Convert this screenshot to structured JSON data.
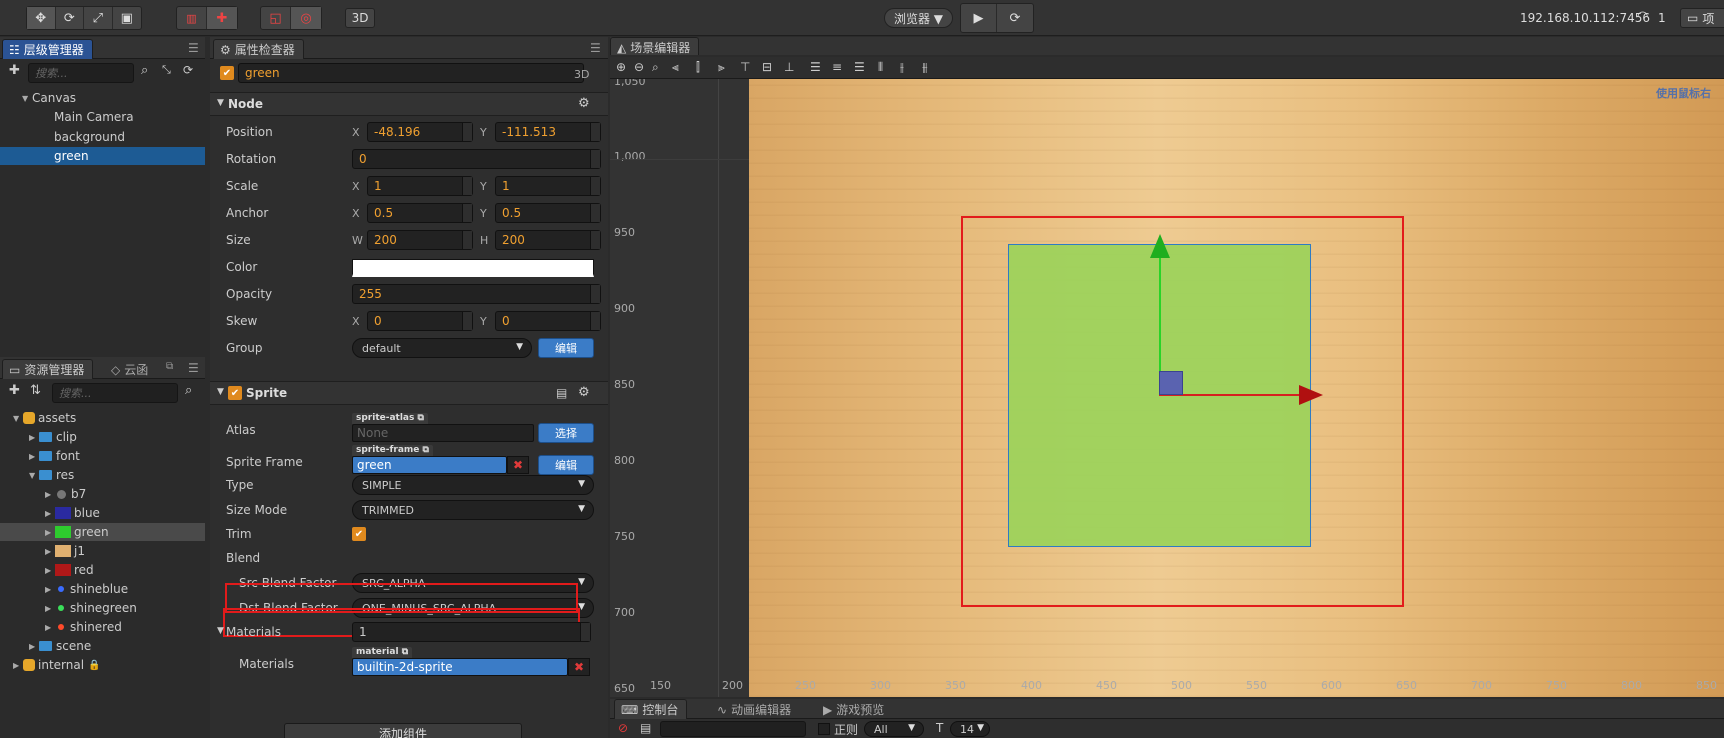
{
  "topbar": {
    "browser_label": "浏览器 ▼",
    "ip": "192.168.10.112:7456",
    "count": "1",
    "project_label": "项",
    "mode_3d": "3D"
  },
  "hierarchy": {
    "tab": "层级管理器",
    "search_placeholder": "搜索...",
    "nodes": [
      {
        "label": "Canvas"
      },
      {
        "label": "Main Camera"
      },
      {
        "label": "background"
      },
      {
        "label": "green"
      }
    ]
  },
  "assets": {
    "tab": "资源管理器",
    "tab2": "云函",
    "search_placeholder": "搜索...",
    "items": [
      {
        "label": "assets"
      },
      {
        "label": "clip"
      },
      {
        "label": "font"
      },
      {
        "label": "res"
      },
      {
        "label": "b7"
      },
      {
        "label": "blue"
      },
      {
        "label": "green"
      },
      {
        "label": "j1"
      },
      {
        "label": "red"
      },
      {
        "label": "shineblue"
      },
      {
        "label": "shinegreen"
      },
      {
        "label": "shinered"
      },
      {
        "label": "scene"
      },
      {
        "label": "internal"
      }
    ]
  },
  "inspector": {
    "tab": "属性检查器",
    "node_name": "green",
    "badge_3d": "3D",
    "node_section": "Node",
    "props": {
      "position": {
        "label": "Position",
        "x_label": "X",
        "x": "-48.196",
        "y_label": "Y",
        "y": "-111.513"
      },
      "rotation": {
        "label": "Rotation",
        "value": "0"
      },
      "scale": {
        "label": "Scale",
        "x_label": "X",
        "x": "1",
        "y_label": "Y",
        "y": "1"
      },
      "anchor": {
        "label": "Anchor",
        "x_label": "X",
        "x": "0.5",
        "y_label": "Y",
        "y": "0.5"
      },
      "size": {
        "label": "Size",
        "w_label": "W",
        "w": "200",
        "h_label": "H",
        "h": "200"
      },
      "color": {
        "label": "Color",
        "value": "#ffffff"
      },
      "opacity": {
        "label": "Opacity",
        "value": "255"
      },
      "skew": {
        "label": "Skew",
        "x_label": "X",
        "x": "0",
        "y_label": "Y",
        "y": "0"
      },
      "group": {
        "label": "Group",
        "value": "default",
        "edit": "编辑"
      }
    },
    "sprite_section": "Sprite",
    "sprite": {
      "atlas": {
        "label": "Atlas",
        "tag": "sprite-atlas",
        "value": "None",
        "btn": "选择"
      },
      "frame": {
        "label": "Sprite Frame",
        "tag": "sprite-frame",
        "value": "green",
        "btn": "编辑"
      },
      "type": {
        "label": "Type",
        "value": "SIMPLE"
      },
      "size_mode": {
        "label": "Size Mode",
        "value": "TRIMMED"
      },
      "trim": {
        "label": "Trim"
      },
      "blend": {
        "label": "Blend"
      },
      "src": {
        "label": "Src Blend Factor",
        "value": "SRC_ALPHA"
      },
      "dst": {
        "label": "Dst Blend Factor",
        "value": "ONE_MINUS_SRC_ALPHA"
      },
      "materials_count": {
        "label": "Materials",
        "value": "1"
      },
      "materials": {
        "label": "Materials",
        "tag": "material",
        "value": "builtin-2d-sprite"
      }
    },
    "add_component": "添加组件"
  },
  "scene": {
    "tab": "场景编辑器",
    "hint": "使用鼠标右",
    "y_ruler": [
      "1,050",
      "1,000",
      "950",
      "900",
      "850",
      "800",
      "750",
      "700",
      "650"
    ],
    "x_ruler": [
      "150",
      "200",
      "250",
      "300",
      "350",
      "400",
      "450",
      "500",
      "550",
      "600",
      "650",
      "700",
      "750",
      "800",
      "850"
    ]
  },
  "bottom": {
    "tabs": [
      "控制台",
      "动画编辑器",
      "游戏预览"
    ],
    "regex_label": "正则",
    "filter_value": "All",
    "font_size": "14"
  },
  "colors": {
    "accent": "#2b5394",
    "selection": "#1d5b94",
    "highlight_red": "#e21b1b",
    "orange_value": "#f0a030",
    "green_sprite": "#9fd15f"
  }
}
